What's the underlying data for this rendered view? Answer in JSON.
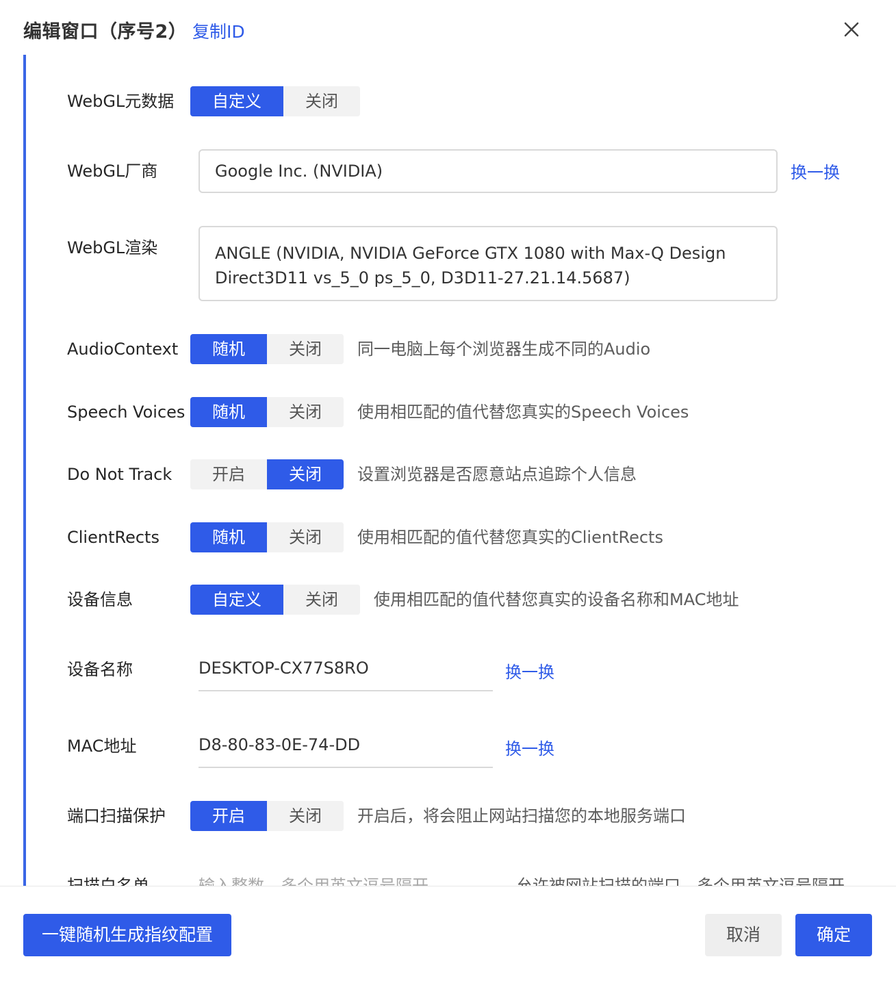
{
  "header": {
    "title": "编辑窗口（序号2）",
    "copy_id": "复制ID",
    "close_icon": "close-icon"
  },
  "rows": {
    "webgl_meta": {
      "label": "WebGL元数据",
      "options": [
        "自定义",
        "关闭"
      ],
      "selected": 0
    },
    "webgl_vendor": {
      "label": "WebGL厂商",
      "value": "Google Inc. (NVIDIA)",
      "swap": "换一换"
    },
    "webgl_render": {
      "label": "WebGL渲染",
      "line1": "ANGLE (NVIDIA, NVIDIA GeForce GTX 1080 with Max-Q Design",
      "line2": "Direct3D11 vs_5_0 ps_5_0, D3D11-27.21.14.5687)"
    },
    "audio": {
      "label": "AudioContext",
      "options": [
        "随机",
        "关闭"
      ],
      "selected": 0,
      "desc": "同一电脑上每个浏览器生成不同的Audio"
    },
    "speech": {
      "label": "Speech Voices",
      "options": [
        "随机",
        "关闭"
      ],
      "selected": 0,
      "desc": "使用相匹配的值代替您真实的Speech Voices"
    },
    "dnt": {
      "label": "Do Not Track",
      "options": [
        "开启",
        "关闭"
      ],
      "selected": 1,
      "desc": "设置浏览器是否愿意站点追踪个人信息"
    },
    "client_rects": {
      "label": "ClientRects",
      "options": [
        "随机",
        "关闭"
      ],
      "selected": 0,
      "desc": "使用相匹配的值代替您真实的ClientRects"
    },
    "device_info": {
      "label": "设备信息",
      "options": [
        "自定义",
        "关闭"
      ],
      "selected": 0,
      "desc": "使用相匹配的值代替您真实的设备名称和MAC地址"
    },
    "device_name": {
      "label": "设备名称",
      "value": "DESKTOP-CX77S8RO",
      "swap": "换一换"
    },
    "mac": {
      "label": "MAC地址",
      "value": "D8-80-83-0E-74-DD",
      "swap": "换一换"
    },
    "port_protect": {
      "label": "端口扫描保护",
      "options": [
        "开启",
        "关闭"
      ],
      "selected": 0,
      "desc": "开启后，将会阻止网站扫描您的本地服务端口"
    },
    "whitelist": {
      "label": "扫描白名单",
      "placeholder": "输入整数，多个用英文逗号隔开",
      "desc": "允许被网站扫描的端口，多个用英文逗号隔开"
    }
  },
  "footer": {
    "random_button": "一键随机生成指纹配置",
    "cancel": "取消",
    "confirm": "确定"
  },
  "colors": {
    "accent": "#2f5be8",
    "segment_bg": "#f2f2f2",
    "border": "#d9d9d9"
  }
}
